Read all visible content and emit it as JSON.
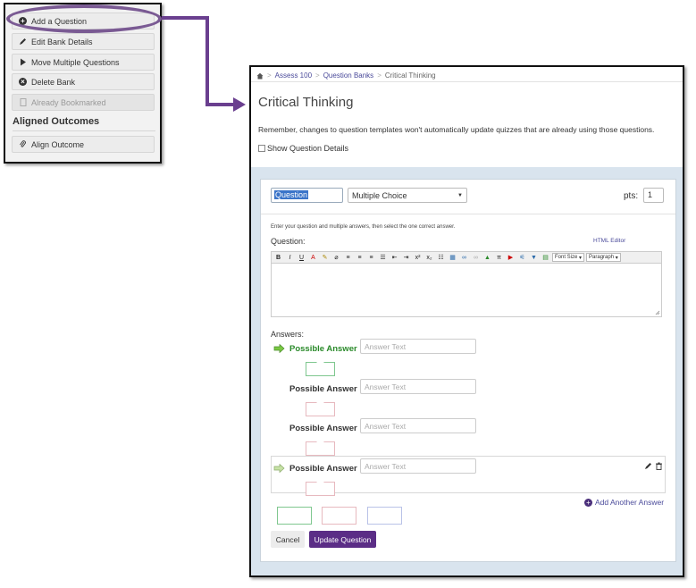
{
  "colors": {
    "accent": "#5b2d86",
    "highlight_oval": "#7a5a93",
    "correct": "#2a8a2a",
    "link": "#4a4a9a"
  },
  "menu": {
    "items": [
      {
        "label": "Add a Question",
        "icon": "plus-circle-icon"
      },
      {
        "label": "Edit Bank Details",
        "icon": "pencil-icon"
      },
      {
        "label": "Move Multiple Questions",
        "icon": "play-icon"
      },
      {
        "label": "Delete Bank",
        "icon": "x-circle-icon"
      },
      {
        "label": "Already Bookmarked",
        "icon": "bookmark-icon"
      }
    ],
    "section_header": "Aligned Outcomes",
    "align_outcome": "Align Outcome"
  },
  "breadcrumb": {
    "items": [
      "Assess 100",
      "Question Banks",
      "Critical Thinking"
    ]
  },
  "page": {
    "title": "Critical Thinking",
    "notice": "Remember, changes to question templates won't automatically update quizzes that are already using those questions.",
    "show_details": "Show Question Details"
  },
  "editor": {
    "question_name": "Question",
    "question_type": "Multiple Choice",
    "pts_label": "pts:",
    "pts_value": "1",
    "instructions": "Enter your question and multiple answers, then select the one correct answer.",
    "question_label": "Question:",
    "html_editor": "HTML Editor",
    "toolbar": {
      "font_size": "Font Size",
      "paragraph": "Paragraph"
    },
    "answers_label": "Answers:",
    "answers": [
      {
        "label": "Possible Answer",
        "placeholder": "Answer Text",
        "correct": true
      },
      {
        "label": "Possible Answer",
        "placeholder": "Answer Text",
        "correct": false
      },
      {
        "label": "Possible Answer",
        "placeholder": "Answer Text",
        "correct": false
      },
      {
        "label": "Possible Answer",
        "placeholder": "Answer Text",
        "correct": false
      }
    ],
    "add_answer": "Add Another Answer",
    "cancel": "Cancel",
    "update": "Update Question"
  }
}
